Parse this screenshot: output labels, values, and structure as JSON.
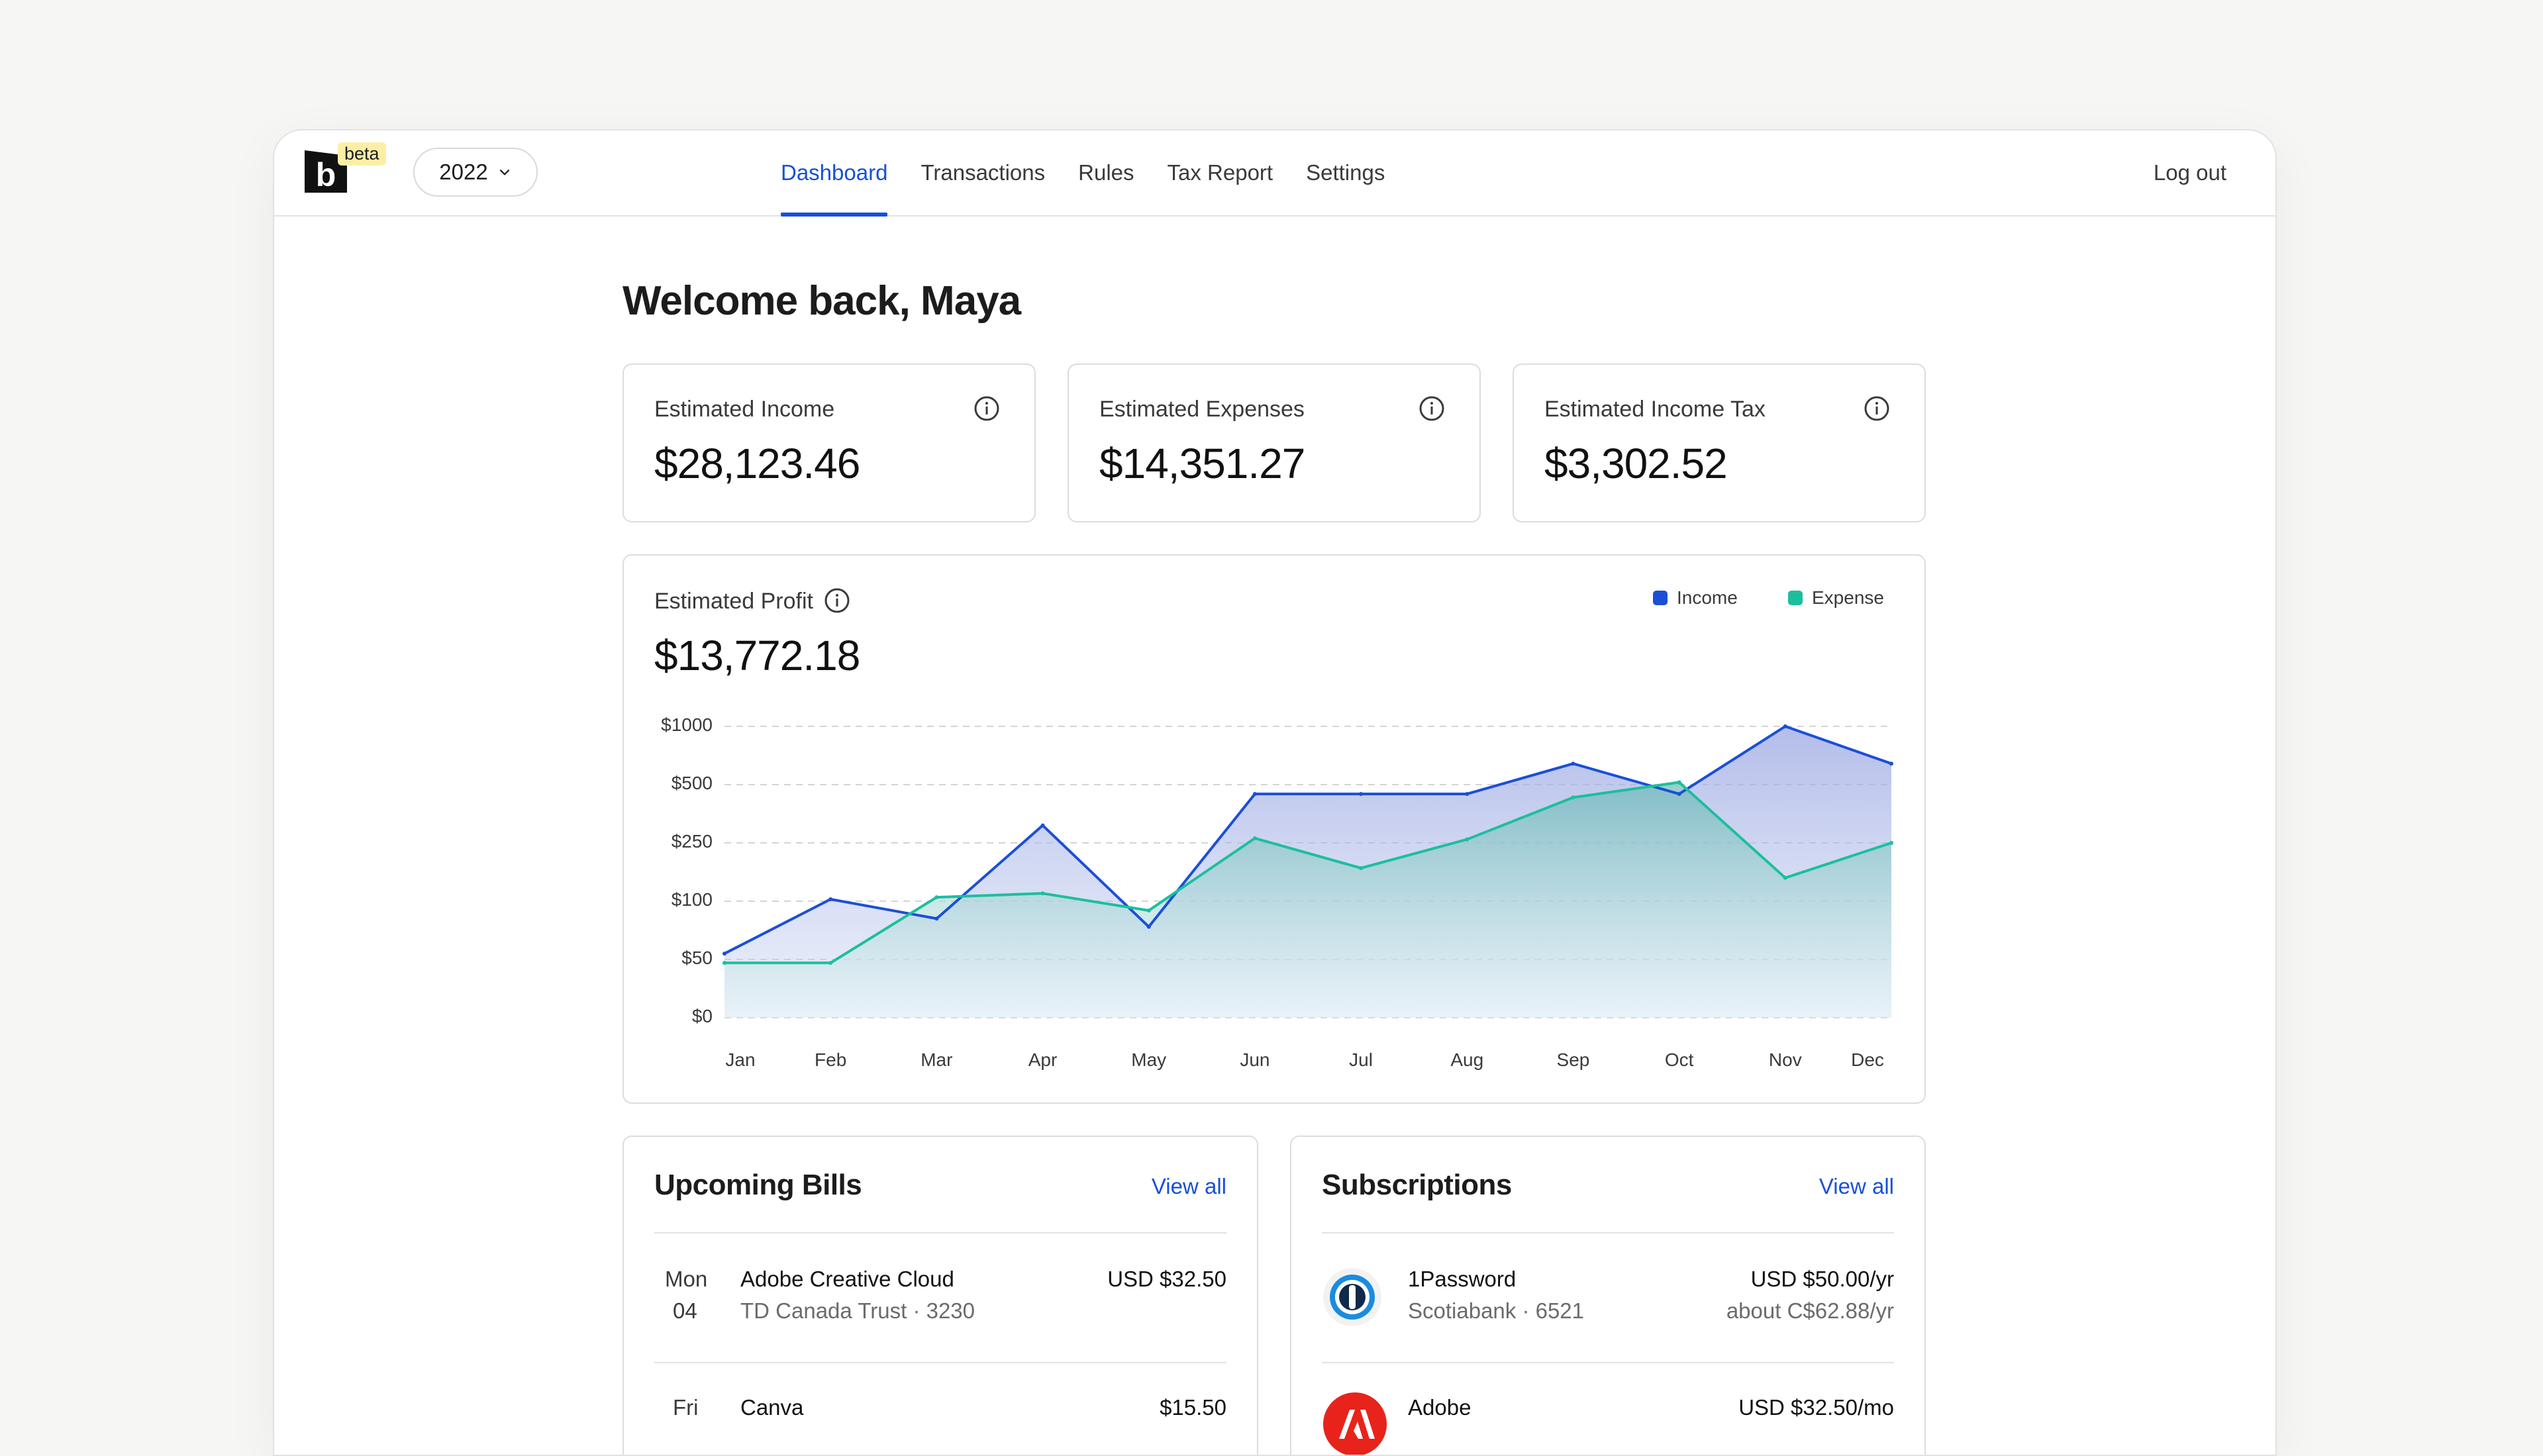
{
  "header": {
    "logo_letter": "b",
    "badge": "beta",
    "year": "2022",
    "nav": [
      "Dashboard",
      "Transactions",
      "Rules",
      "Tax Report",
      "Settings"
    ],
    "active_nav": "Dashboard",
    "logout": "Log out"
  },
  "welcome": "Welcome back, Maya",
  "stats": [
    {
      "label": "Estimated Income",
      "value": "$28,123.46"
    },
    {
      "label": "Estimated Expenses",
      "value": "$14,351.27"
    },
    {
      "label": "Estimated Income Tax",
      "value": "$3,302.52"
    }
  ],
  "profit": {
    "label": "Estimated Profit",
    "value": "$13,772.18"
  },
  "colors": {
    "accent": "#1650d9",
    "income": "#1a4fd6",
    "expense": "#1bbf9e"
  },
  "chart_data": {
    "type": "area",
    "categories": [
      "Jan",
      "Feb",
      "Mar",
      "Apr",
      "May",
      "Jun",
      "Jul",
      "Aug",
      "Sep",
      "Oct",
      "Nov",
      "Dec"
    ],
    "y_ticks": [
      "$0",
      "$50",
      "$100",
      "$250",
      "$500",
      "$1000"
    ],
    "series": [
      {
        "name": "Income",
        "values": [
          55,
          105,
          85,
          325,
          78,
          460,
          460,
          460,
          680,
          460,
          1000,
          680
        ]
      },
      {
        "name": "Expense",
        "values": [
          47,
          47,
          110,
          120,
          92,
          270,
          185,
          265,
          445,
          520,
          160,
          250
        ]
      }
    ],
    "legend": "top-right",
    "grid": true
  },
  "bills": {
    "title": "Upcoming Bills",
    "view_all": "View all",
    "items": [
      {
        "day": "Mon",
        "date": "04",
        "name": "Adobe Creative Cloud",
        "account": "TD Canada Trust · 3230",
        "amount": "USD $32.50"
      },
      {
        "day": "Fri",
        "date": "",
        "name": "Canva",
        "account": "",
        "amount": "$15.50"
      }
    ]
  },
  "subscriptions": {
    "title": "Subscriptions",
    "view_all": "View all",
    "items": [
      {
        "name": "1Password",
        "account": "Scotiabank · 6521",
        "amount": "USD $50.00/yr",
        "converted": "about C$62.88/yr",
        "icon": "1password-icon"
      },
      {
        "name": "Adobe",
        "account": "",
        "amount": "USD $32.50/mo",
        "converted": "",
        "icon": "adobe-icon"
      }
    ]
  }
}
